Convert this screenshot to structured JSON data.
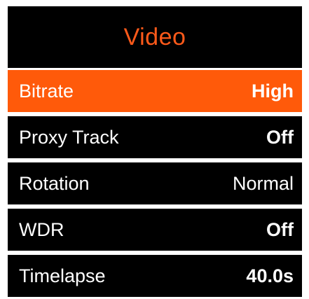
{
  "colors": {
    "accent": "#ff5a0a",
    "background": "#000000",
    "text": "#ffffff",
    "divider": "#ffffff"
  },
  "header": {
    "title": "Video"
  },
  "menu": {
    "items": [
      {
        "label": "Bitrate",
        "value": "High",
        "selected": true
      },
      {
        "label": "Proxy Track",
        "value": "Off",
        "selected": false
      },
      {
        "label": "Rotation",
        "value": "Normal",
        "selected": false
      },
      {
        "label": "WDR",
        "value": "Off",
        "selected": false
      },
      {
        "label": "Timelapse",
        "value": "40.0s",
        "selected": false
      }
    ]
  }
}
